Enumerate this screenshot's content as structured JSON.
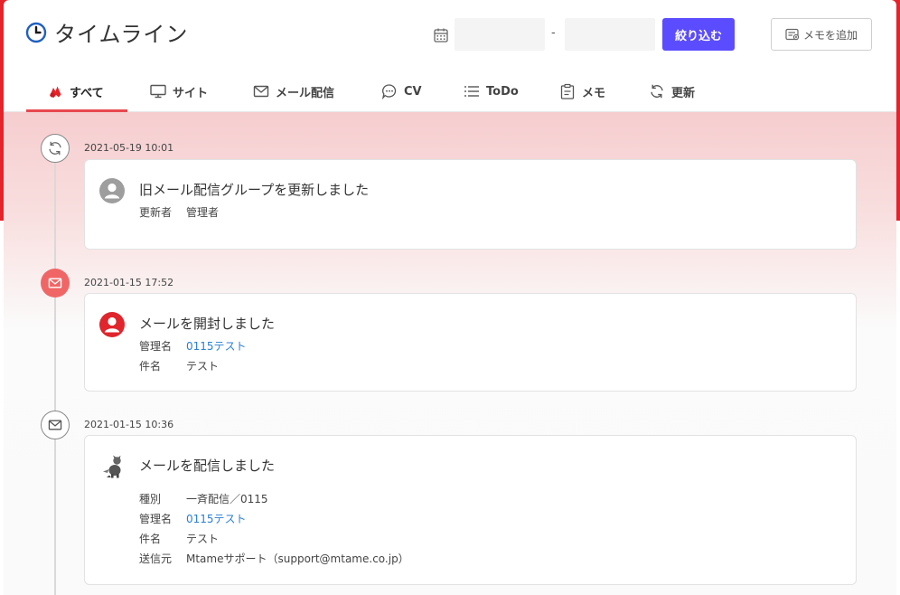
{
  "header": {
    "title": "タイムライン",
    "date_from": "",
    "date_to": "",
    "date_separator": "-",
    "filter_label": "絞り込む",
    "add_memo_label": "メモを追加"
  },
  "tabs": [
    {
      "label": "すべて",
      "icon": "fire-icon",
      "active": true
    },
    {
      "label": "サイト",
      "icon": "monitor-icon"
    },
    {
      "label": "メール配信",
      "icon": "mail-icon"
    },
    {
      "label": "CV",
      "icon": "chat-icon"
    },
    {
      "label": "ToDo",
      "icon": "list-icon"
    },
    {
      "label": "メモ",
      "icon": "clipboard-icon"
    },
    {
      "label": "更新",
      "icon": "refresh-icon"
    }
  ],
  "colors": {
    "brand_red": "#e5232a",
    "primary_button": "#5b4cff",
    "link": "#2a7fd4",
    "node_red": "#f06666"
  },
  "events": [
    {
      "timestamp": "2021-05-19 10:01",
      "node_icon": "refresh-icon",
      "avatar": "user-gray-icon",
      "title": "旧メール配信グループを更新しました",
      "rows": [
        {
          "key": "更新者",
          "value": "管理者"
        }
      ]
    },
    {
      "timestamp": "2021-01-15 17:52",
      "node_icon": "mail-icon",
      "avatar": "user-red-icon",
      "title": "メールを開封しました",
      "rows": [
        {
          "key": "管理名",
          "value": "0115テスト",
          "link": true
        },
        {
          "key": "件名",
          "value": "テスト"
        }
      ]
    },
    {
      "timestamp": "2021-01-15 10:36",
      "node_icon": "mail-icon",
      "avatar": "dog-icon",
      "title": "メールを配信しました",
      "rows": [
        {
          "key": "種別",
          "value": "一斉配信／0115"
        },
        {
          "key": "管理名",
          "value": "0115テスト",
          "link": true
        },
        {
          "key": "件名",
          "value": "テスト"
        },
        {
          "key": "送信元",
          "value": "Mtameサポート（support@mtame.co.jp）"
        }
      ]
    }
  ]
}
